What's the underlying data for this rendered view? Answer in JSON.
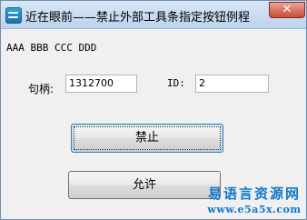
{
  "window": {
    "title": "近在眼前——禁止外部工具条指定按钮例程",
    "close_label": "✕"
  },
  "content": {
    "text_line": "AAA BBB CCC DDD",
    "handle_label": "句柄:",
    "handle_value": "1312700",
    "id_label": "ID:",
    "id_value": "2",
    "disable_button": "禁止",
    "enable_button": "允许"
  },
  "watermark": {
    "line1": "易语言资源网",
    "line2": "www.e5a5x.com"
  }
}
